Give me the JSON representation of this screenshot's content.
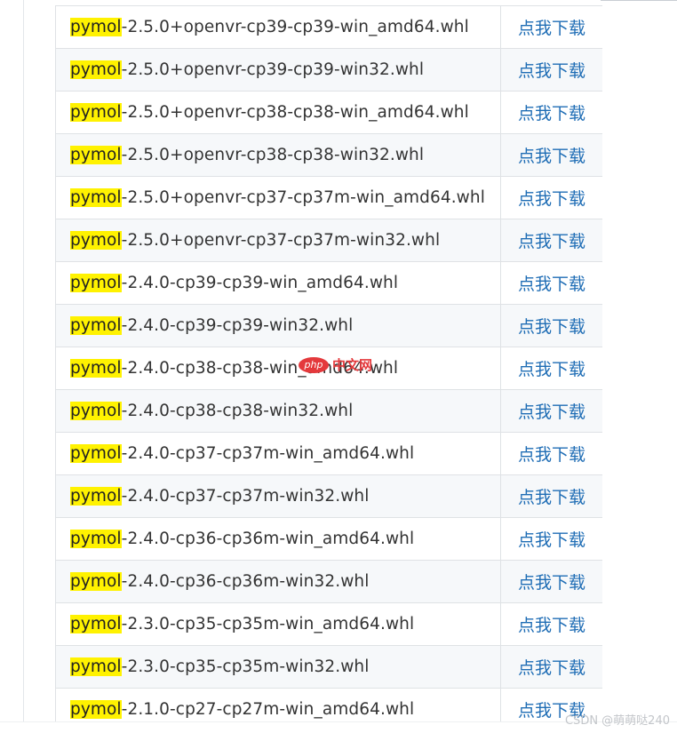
{
  "downloads": {
    "highlight_term": "pymol",
    "link_label": "点我下载",
    "rows": [
      "-2.5.0+openvr-cp39-cp39-win_amd64.whl",
      "-2.5.0+openvr-cp39-cp39-win32.whl",
      "-2.5.0+openvr-cp38-cp38-win_amd64.whl",
      "-2.5.0+openvr-cp38-cp38-win32.whl",
      "-2.5.0+openvr-cp37-cp37m-win_amd64.whl",
      "-2.5.0+openvr-cp37-cp37m-win32.whl",
      "-2.4.0-cp39-cp39-win_amd64.whl",
      "-2.4.0-cp39-cp39-win32.whl",
      "-2.4.0-cp38-cp38-win_amd64.whl",
      "-2.4.0-cp38-cp38-win32.whl",
      "-2.4.0-cp37-cp37m-win_amd64.whl",
      "-2.4.0-cp37-cp37m-win32.whl",
      "-2.4.0-cp36-cp36m-win_amd64.whl",
      "-2.4.0-cp36-cp36m-win32.whl",
      "-2.3.0-cp35-cp35m-win_amd64.whl",
      "-2.3.0-cp35-cp35m-win32.whl",
      "-2.1.0-cp27-cp27m-win_amd64.whl"
    ]
  },
  "watermark": {
    "logo_text": "php",
    "site_text": "中文网"
  },
  "footer": {
    "credit": "CSDN @萌萌哒240"
  },
  "colors": {
    "highlight": "#fff200",
    "link": "#1f6db5",
    "stripe": "#f6f8fa",
    "border": "#dfe2e5",
    "watermark": "#e4393c"
  }
}
